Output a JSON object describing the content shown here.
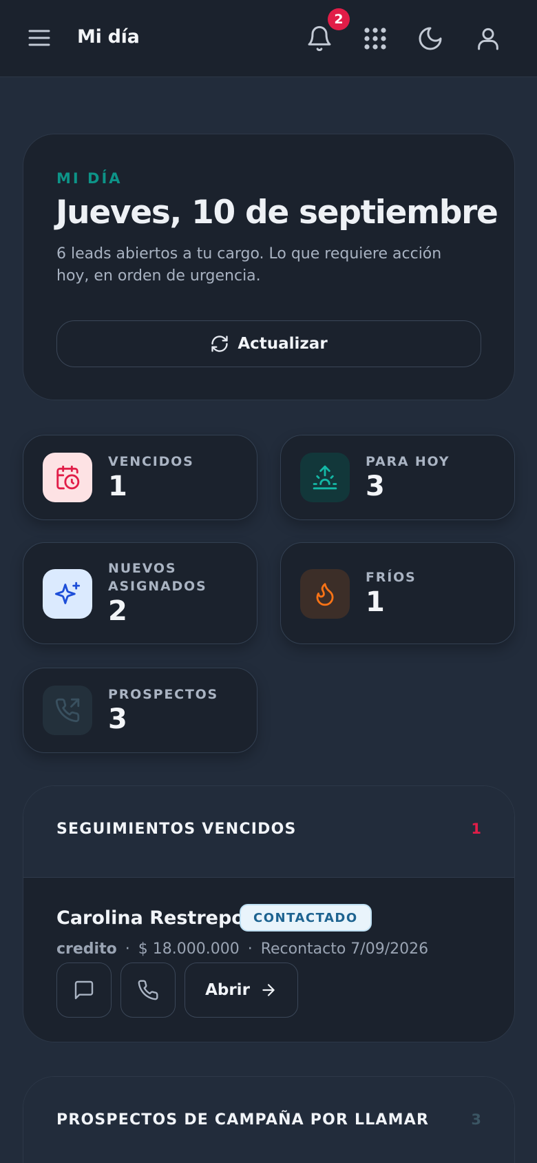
{
  "header": {
    "title": "Mi día",
    "notifications_count": "2"
  },
  "hero": {
    "eyebrow": "MI DÍA",
    "title": "Jueves, 10 de septiembre",
    "subtitle": "6 leads abiertos a tu cargo. Lo que requiere acción hoy, en orden de urgencia.",
    "refresh_label": "Actualizar"
  },
  "stats": [
    {
      "label": "VENCIDOS",
      "value": "1",
      "icon": "calendar-clock-icon",
      "bg": "#fde2e4",
      "color": "#e11d48"
    },
    {
      "label": "PARA HOY",
      "value": "3",
      "icon": "sunrise-icon",
      "bg": "#12373a",
      "color": "#14b8a6"
    },
    {
      "label": "NUEVOS ASIGNADOS",
      "value": "2",
      "icon": "sparkles-icon",
      "bg": "#dbeafe",
      "color": "#1d4ed8"
    },
    {
      "label": "FRÍOS",
      "value": "1",
      "icon": "flame-icon",
      "bg": "#3c2e28",
      "color": "#f97316"
    },
    {
      "label": "PROSPECTOS",
      "value": "3",
      "icon": "phone-outgoing-icon",
      "bg": "#23303b",
      "color": "#39505f"
    }
  ],
  "sections": {
    "overdue": {
      "title": "SEGUIMIENTOS VENCIDOS",
      "count": "1",
      "count_color": "#e11d48",
      "lead": {
        "name": "Carolina Restrepo",
        "status": "CONTACTADO",
        "product": "credito",
        "amount": "$ 18.000.000",
        "recontact": "Recontacto 7/09/2026",
        "open_label": "Abrir"
      }
    },
    "campaign": {
      "title": "PROSPECTOS DE CAMPAÑA POR LLAMAR",
      "count": "3",
      "count_color": "#3b5563"
    }
  }
}
